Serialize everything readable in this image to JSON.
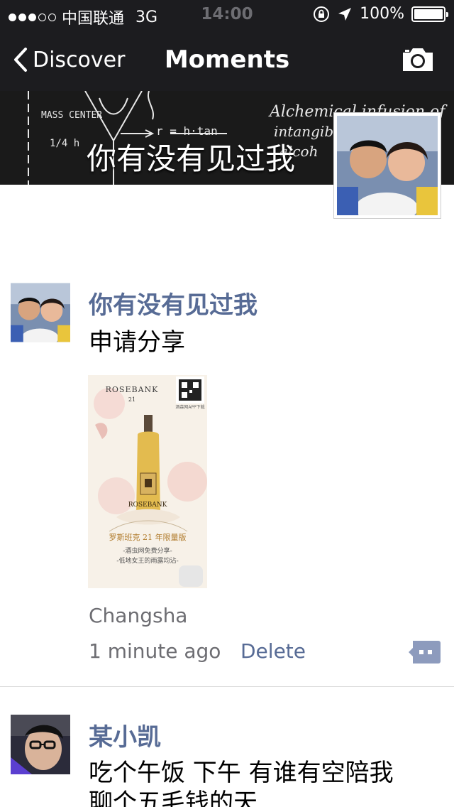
{
  "status_bar": {
    "carrier": "中国联通",
    "network": "3G",
    "time": "14:00",
    "battery": "100%"
  },
  "nav": {
    "back_label": "Discover",
    "title": "Moments"
  },
  "cover": {
    "name": "你有没有见过我",
    "chalk": {
      "mass_center": "MASS CENTER",
      "fraction": "1/4 h",
      "equation": "r = h·tan",
      "alchemical": "Alchemical infusion of",
      "intangible": "intangible",
      "alcoh": "alcoh"
    }
  },
  "posts": [
    {
      "username": "你有没有见过我",
      "text": "申请分享",
      "image": {
        "brand": "ROSEBANK",
        "age_small": "21",
        "bottle_brand": "ROSEBANK",
        "title": "罗斯班克 21 年限量版",
        "line1": "-酒虫网免费分享-",
        "line2": "-低地女王的雨露均沾-",
        "qr_caption": "酒森网APP下载"
      },
      "location": "Changsha",
      "time": "1 minute ago",
      "delete_label": "Delete"
    },
    {
      "username": "某小凯",
      "text_line1": "吃个午饭 下午 有谁有空陪我",
      "text_line2": "聊个五毛钱的天"
    }
  ],
  "colors": {
    "nav_bg": "#1c1c1f",
    "link_blue": "#576b95",
    "meta_gray": "#6d6d72",
    "comment_icon": "#8d9bbd"
  }
}
